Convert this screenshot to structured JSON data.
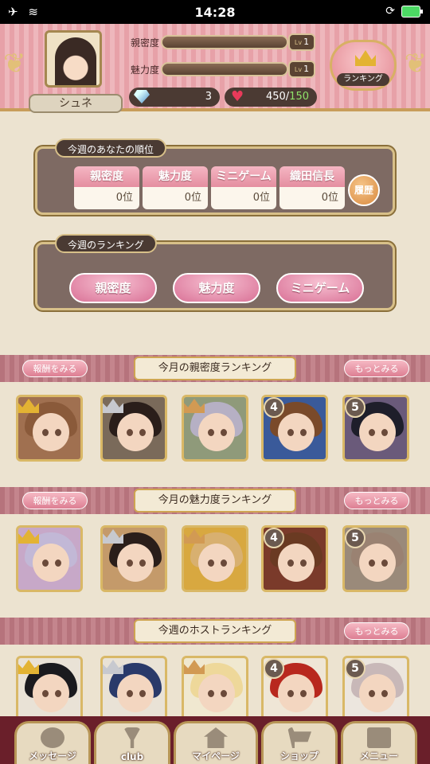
{
  "status_bar": {
    "time": "14:28"
  },
  "header": {
    "player_name": "シュネ",
    "stats": [
      {
        "label": "親密度",
        "lv_label": "Lv",
        "level": "1"
      },
      {
        "label": "魅力度",
        "lv_label": "Lv",
        "level": "1"
      }
    ],
    "gems": "3",
    "hearts_current": "450",
    "hearts_separator": "/",
    "hearts_max": "150",
    "ranking_button_label": "ランキング"
  },
  "my_rank_panel": {
    "title": "今週のあなたの順位",
    "columns": [
      {
        "label": "親密度",
        "value": "0位"
      },
      {
        "label": "魅力度",
        "value": "0位"
      },
      {
        "label": "ミニゲーム",
        "value": "0位"
      },
      {
        "label": "織田信長",
        "value": "0位"
      }
    ],
    "history_label": "履歴"
  },
  "weekly_ranking_panel": {
    "title": "今週のランキング",
    "buttons": [
      "親密度",
      "魅力度",
      "ミニゲーム"
    ]
  },
  "sections": [
    {
      "title": "今月の親密度ランキング",
      "reward_label": "報酬をみる",
      "more_label": "もっとみる",
      "ranks": [
        "gold",
        "silver",
        "bronze",
        "4",
        "5"
      ]
    },
    {
      "title": "今月の魅力度ランキング",
      "reward_label": "報酬をみる",
      "more_label": "もっとみる",
      "ranks": [
        "gold",
        "silver",
        "bronze",
        "4",
        "5"
      ]
    },
    {
      "title": "今週のホストランキング",
      "more_label": "もっとみる",
      "ranks": [
        "gold",
        "silver",
        "bronze",
        "4",
        "5"
      ]
    }
  ],
  "nav": [
    {
      "label": "メッセージ",
      "icon": "chat-bubble-icon"
    },
    {
      "label": "club",
      "icon": "champagne-glass-icon"
    },
    {
      "label": "マイページ",
      "icon": "home-icon"
    },
    {
      "label": "ショップ",
      "icon": "cart-icon"
    },
    {
      "label": "メニュー",
      "icon": "book-icon"
    }
  ],
  "colors": {
    "accent_pink": "#e48ea0",
    "frame_gold": "#d8c089",
    "panel_brown": "#7e6a63",
    "heart_max_green": "#8fe36a"
  }
}
